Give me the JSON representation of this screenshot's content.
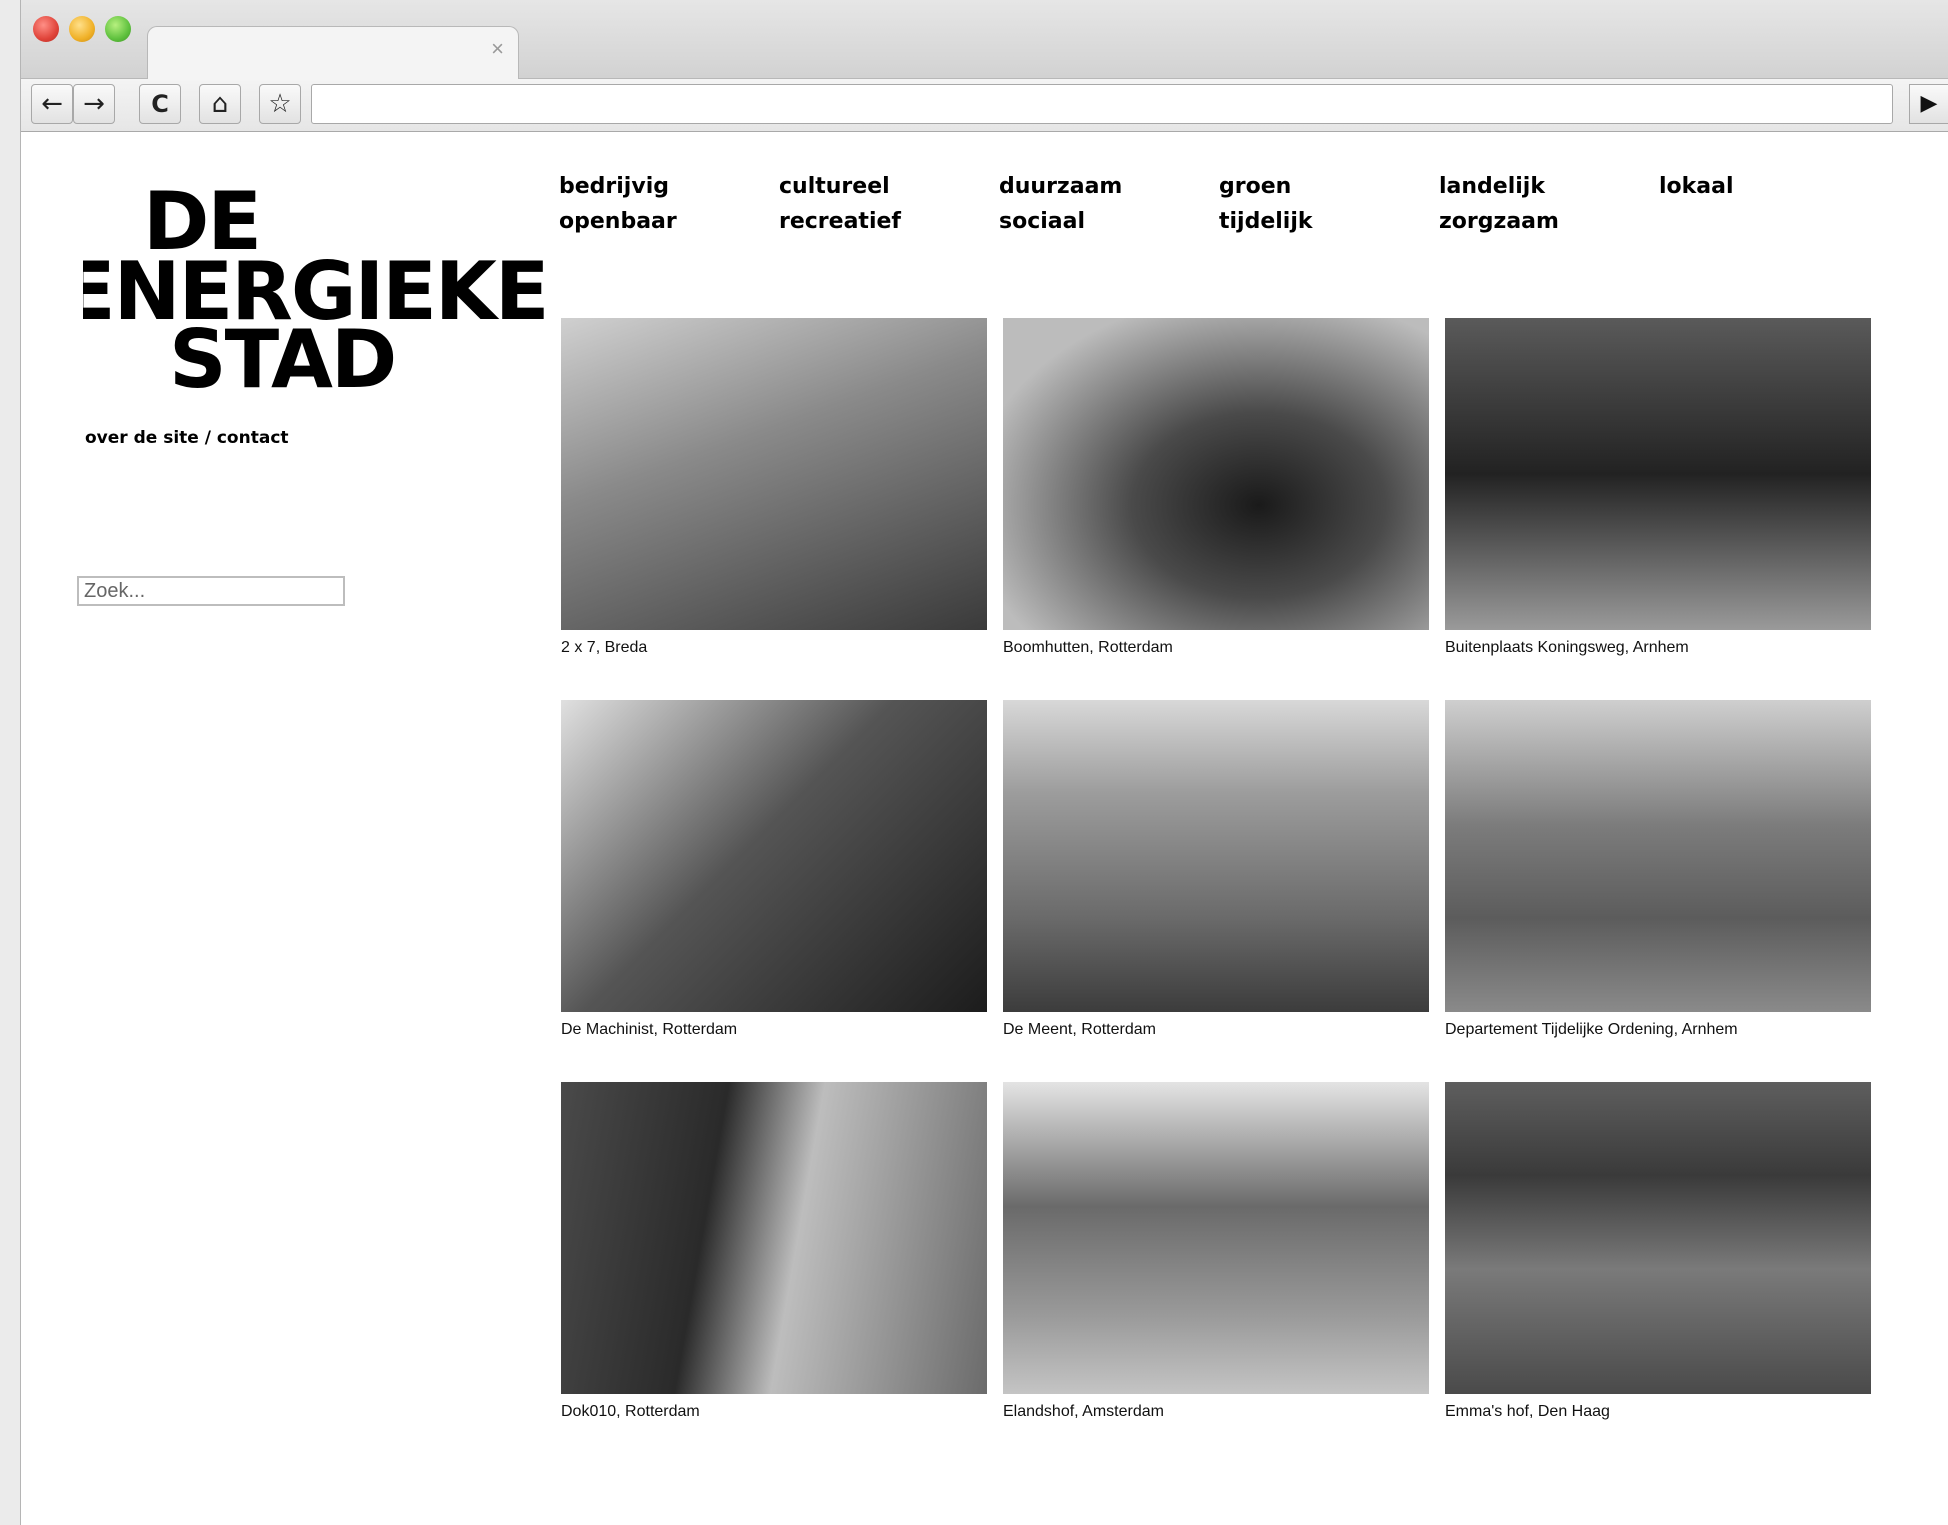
{
  "browser": {
    "tab_close": "×",
    "back": "←",
    "forward": "→",
    "reload": "C",
    "home": "⌂",
    "bookmark": "☆",
    "menu": "▶"
  },
  "site": {
    "logo_lines": [
      "DE",
      "ENERGIEKE",
      "STAD"
    ],
    "about_link": "over de site",
    "separator": " / ",
    "contact_link": "contact",
    "search_placeholder": "Zoek..."
  },
  "nav": [
    "bedrijvig",
    "cultureel",
    "duurzaam",
    "groen",
    "landelijk",
    "lokaal",
    "openbaar",
    "recreatief",
    "sociaal",
    "tijdelijk",
    "zorgzaam"
  ],
  "projects": [
    {
      "caption": "2 x 7, Breda"
    },
    {
      "caption": "Boomhutten, Rotterdam"
    },
    {
      "caption": "Buitenplaats Koningsweg, Arnhem"
    },
    {
      "caption": "De Machinist, Rotterdam"
    },
    {
      "caption": "De Meent, Rotterdam"
    },
    {
      "caption": "Departement Tijdelijke Ordening, Arnhem"
    },
    {
      "caption": "Dok010, Rotterdam"
    },
    {
      "caption": "Elandshof, Amsterdam"
    },
    {
      "caption": "Emma's hof, Den Haag"
    }
  ],
  "colors": {
    "photo_tone": "#7a7a7a",
    "text": "#000000"
  }
}
